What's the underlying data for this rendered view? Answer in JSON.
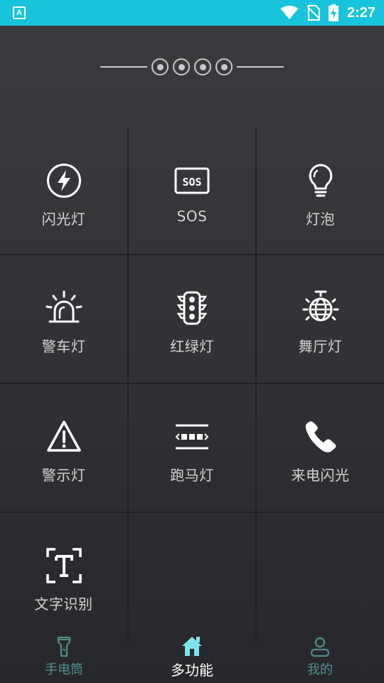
{
  "status_bar": {
    "time": "2:27",
    "notification_icon_letter": "A",
    "icons": [
      "wifi-icon",
      "no-sim-icon",
      "battery-charging-icon"
    ],
    "background_color": "#17c4dc"
  },
  "features": [
    {
      "label": "闪光灯",
      "icon": "flash-icon"
    },
    {
      "label": "SOS",
      "icon": "sos-icon"
    },
    {
      "label": "灯泡",
      "icon": "bulb-icon"
    },
    {
      "label": "警车灯",
      "icon": "police-light-icon"
    },
    {
      "label": "红绿灯",
      "icon": "traffic-light-icon"
    },
    {
      "label": "舞厅灯",
      "icon": "disco-ball-icon"
    },
    {
      "label": "警示灯",
      "icon": "warning-icon"
    },
    {
      "label": "跑马灯",
      "icon": "marquee-icon"
    },
    {
      "label": "来电闪光",
      "icon": "phone-icon"
    },
    {
      "label": "文字识别",
      "icon": "text-recognition-icon"
    }
  ],
  "bottom_nav": [
    {
      "label": "手电筒",
      "icon": "flashlight-icon",
      "active": false
    },
    {
      "label": "多功能",
      "icon": "home-icon",
      "active": true
    },
    {
      "label": "我的",
      "icon": "user-icon",
      "active": false
    }
  ],
  "colors": {
    "accent": "#17c4dc",
    "nav_inactive": "#4f8f8d",
    "nav_active_icon": "#7ee3ea",
    "icon_color": "#ffffff"
  }
}
